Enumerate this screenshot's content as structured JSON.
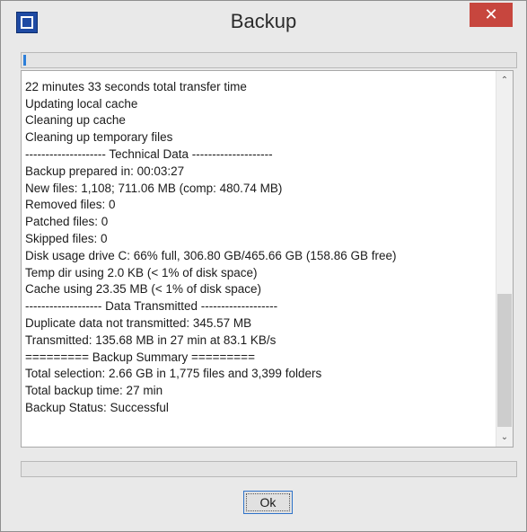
{
  "window": {
    "title": "Backup",
    "close_symbol": "✕",
    "app_icon": "app-icon"
  },
  "progress_top": {
    "percent": 0.6
  },
  "log": {
    "lines": [
      "",
      "22 minutes 33 seconds total transfer time",
      "Updating local cache",
      "Cleaning up cache",
      "Cleaning up temporary files",
      "-------------------- Technical Data --------------------",
      "Backup prepared in: 00:03:27",
      "New files: 1,108; 711.06 MB (comp: 480.74 MB)",
      "Removed files: 0",
      "Patched files: 0",
      "Skipped files: 0",
      "Disk usage drive C: 66% full, 306.80 GB/465.66 GB (158.86 GB free)",
      "Temp dir using 2.0 KB (< 1% of disk space)",
      "Cache using 23.35 MB (< 1% of disk space)",
      "------------------- Data Transmitted -------------------",
      "Duplicate data not transmitted: 345.57 MB",
      "Transmitted: 135.68 MB in 27 min at 83.1 KB/s",
      "========= Backup Summary =========",
      "Total selection: 2.66 GB in 1,775 files and 3,399 folders",
      "Total backup time: 27 min",
      "Backup Status: Successful"
    ]
  },
  "scrollbar": {
    "up_arrow": "⌃",
    "down_arrow": "⌄"
  },
  "progress_bottom": {
    "percent": 0
  },
  "buttons": {
    "ok_label": "Ok"
  }
}
